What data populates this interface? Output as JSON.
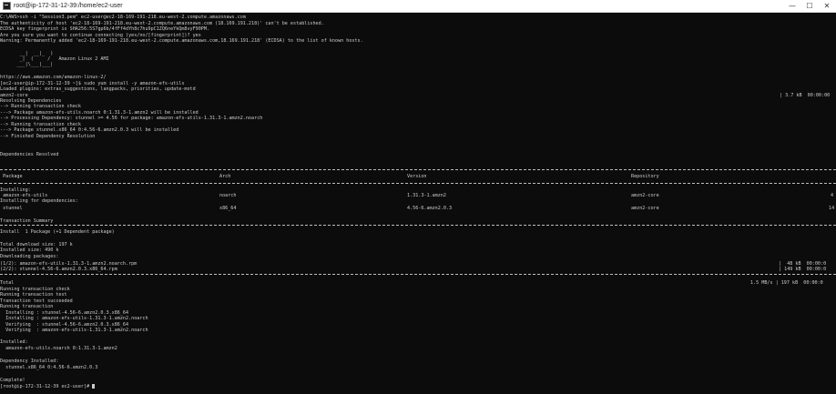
{
  "window": {
    "title": "root@ip-172-31-12-39:/home/ec2-user",
    "minimize_glyph": "—",
    "maximize_glyph": "☐",
    "close_glyph": "✕"
  },
  "terminal": {
    "ssh_command": "C:\\AWS>ssh -i \"Session3.pem\" ec2-user@ec2-18-169-191-218.eu-west-2.compute.amazonaws.com",
    "auth_warning": "The authenticity of host 'ec2-18-169-191-218.eu-west-2.compute.amazonaws.com (18.169.191.218)' can't be established.",
    "fingerprint": "ECDSA key fingerprint is SHA256:5S7gp6b/4fFf4dYh8c7hu9pC1ZQ6neYkQm8vyF90PM.",
    "continue_prompt": "Are you sure you want to continue connecting (yes/no/[fingerprint])? yes",
    "known_hosts": "Warning: Permanently added 'ec2-18-169-191-218.eu-west-2.compute.amazonaws.com,18.169.191.218' (ECDSA) to the list of known hosts.",
    "ascii_1": "       __|  __|_  )",
    "ascii_2": "       _|  (     /   Amazon Linux 2 AMI",
    "ascii_3": "      ___|\\___|___|",
    "ami_url": "https://aws.amazon.com/amazon-linux-2/",
    "yum_command": "[ec2-user@ip-172-31-12-39 ~]$ sudo yum install -y amazon-efs-utils",
    "plugins": "Loaded plugins: extras_suggestions, langpacks, priorities, update-motd",
    "repo_name": "amzn2-core",
    "repo_stats": "| 3.7 kB  00:00:00",
    "resolving": "Resolving Dependencies",
    "dep_1": "--> Running transaction check",
    "dep_2": "---> Package amazon-efs-utils.noarch 0:1.31.3-1.amzn2 will be installed",
    "dep_3": "--> Processing Dependency: stunnel >= 4.56 for package: amazon-efs-utils-1.31.3-1.amzn2.noarch",
    "dep_4": "--> Running transaction check",
    "dep_5": "---> Package stunnel.x86_64 0:4.56-6.amzn2.0.3 will be installed",
    "dep_6": "--> Finished Dependency Resolution",
    "deps_resolved": "Dependencies Resolved",
    "table_headers": {
      "package": " Package",
      "arch": "Arch",
      "version": "Version",
      "repository": "Repository"
    },
    "installing_label": "Installing:",
    "row1": {
      "package": " amazon-efs-utils",
      "arch": "noarch",
      "version": "1.31.3-1.amzn2",
      "repository": "amzn2-core",
      "size": "4"
    },
    "installing_deps_label": "Installing for dependencies:",
    "row2": {
      "package": " stunnel",
      "arch": "x86_64",
      "version": "4.56-6.amzn2.0.3",
      "repository": "amzn2-core",
      "size": "14"
    },
    "transaction_summary": "Transaction Summary",
    "install_summary": "Install  1 Package (+1 Dependent package)",
    "total_download": "Total download size: 197 k",
    "installed_size": "Installed size: 490 k",
    "downloading": "Downloading packages:",
    "dl1": "(1/2): amazon-efs-utils-1.31.3-1.amzn2.noarch.rpm",
    "dl1_stats": "|  48 kB  00:00:0",
    "dl2": "(2/2): stunnel-4.56-6.amzn2.0.3.x86_64.rpm",
    "dl2_stats": "| 149 kB  00:00:0",
    "total_label": "Total",
    "total_stats": "1.5 MB/s | 197 kB  00:00:0",
    "tx1": "Running transaction check",
    "tx2": "Running transaction test",
    "tx3": "Transaction test succeeded",
    "tx4": "Running transaction",
    "tx5": "  Installing : stunnel-4.56-6.amzn2.0.3.x86_64",
    "tx6": "  Installing : amazon-efs-utils-1.31.3-1.amzn2.noarch",
    "tx7": "  Verifying  : stunnel-4.56-6.amzn2.0.3.x86_64",
    "tx8": "  Verifying  : amazon-efs-utils-1.31.3-1.amzn2.noarch",
    "installed_label": "Installed:",
    "installed_pkg": "  amazon-efs-utils.noarch 0:1.31.3-1.amzn2",
    "dep_installed_label": "Dependency Installed:",
    "dep_installed_pkg": "  stunnel.x86_64 0:4.56-6.amzn2.0.3",
    "complete": "Complete!",
    "final_prompt": "[root@ip-172-31-12-39 ec2-user]# "
  }
}
